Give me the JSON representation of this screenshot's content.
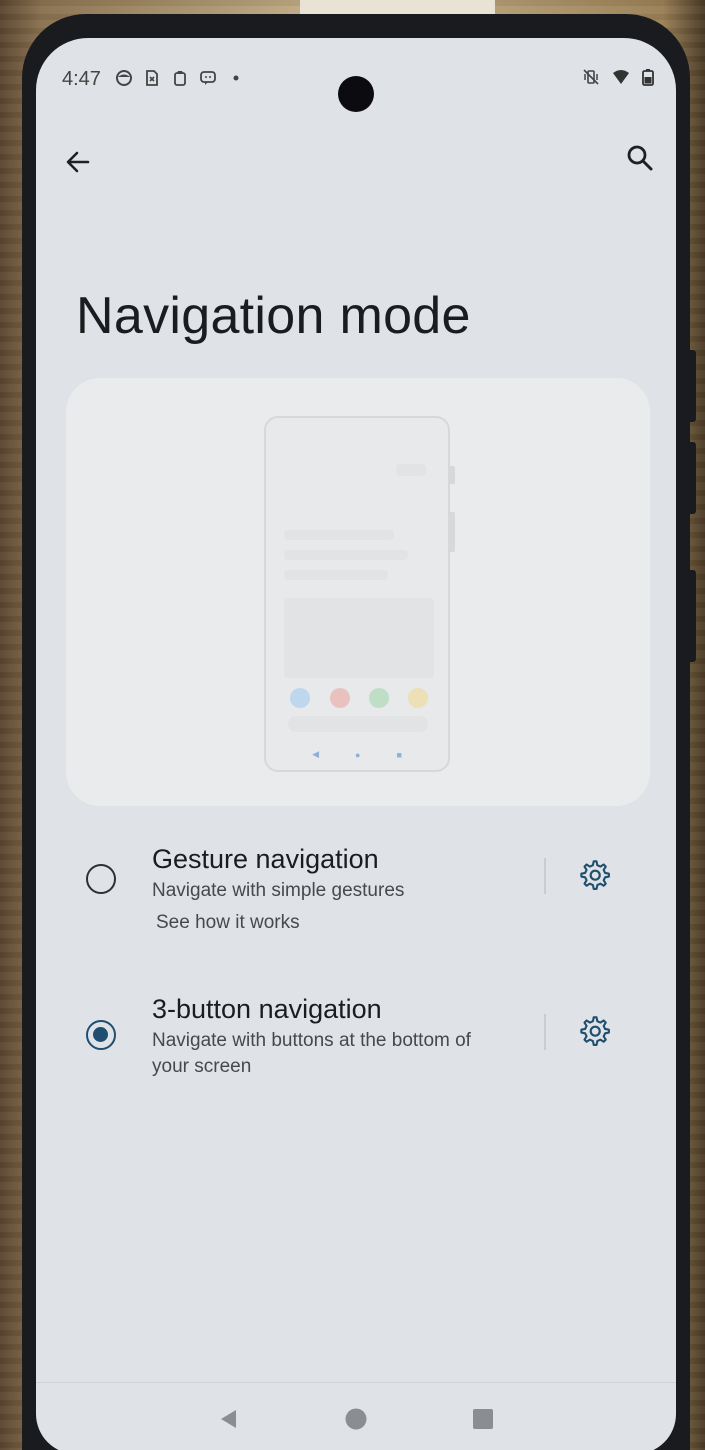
{
  "status_bar": {
    "time": "4:47",
    "left_icons": [
      "app-face-icon",
      "sim-x-icon",
      "clipboard-icon",
      "chat-icon",
      "dot-icon"
    ],
    "right_icons": [
      "vibrate-off-icon",
      "wifi-icon",
      "battery-icon"
    ]
  },
  "toolbar": {
    "back_icon": "arrow-left-icon",
    "search_icon": "search-icon"
  },
  "page": {
    "title": "Navigation mode"
  },
  "preview": {
    "dot_colors": [
      "#9cc9ee",
      "#eaa29c",
      "#9fd4a6",
      "#f1d98a"
    ],
    "nav_glyphs": [
      "◀",
      "●",
      "■"
    ]
  },
  "options": [
    {
      "title": "Gesture navigation",
      "subtitle": "Navigate with simple gestures",
      "link": "See how it works",
      "selected": false
    },
    {
      "title": "3-button navigation",
      "subtitle": "Navigate with buttons at the bottom of your screen",
      "link": "",
      "selected": true
    }
  ],
  "colors": {
    "accent": "#1f4e6e",
    "screen_bg": "#dfe3e7"
  }
}
